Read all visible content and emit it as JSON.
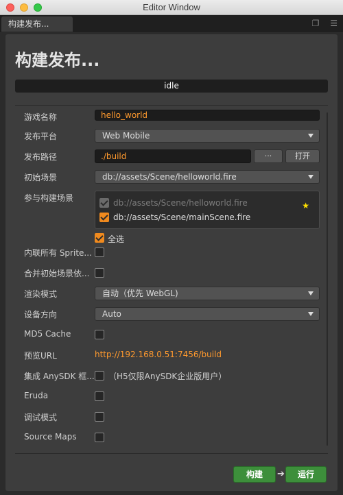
{
  "window": {
    "title": "Editor Window"
  },
  "tab": {
    "label": "构建发布..."
  },
  "panel": {
    "heading": "构建发布...",
    "status": "idle"
  },
  "fields": {
    "game_name": {
      "label": "游戏名称",
      "value": "hello_world"
    },
    "platform": {
      "label": "发布平台",
      "value": "Web Mobile"
    },
    "build_path": {
      "label": "发布路径",
      "value": "./build",
      "browse_label": "···",
      "open_label": "打开"
    },
    "start_scene": {
      "label": "初始场景",
      "value": "db://assets/Scene/helloworld.fire"
    },
    "build_scenes": {
      "label": "参与构建场景",
      "items": [
        {
          "name": "db://assets/Scene/helloworld.fire",
          "checked": true,
          "disabled": true
        },
        {
          "name": "db://assets/Scene/mainScene.fire",
          "checked": true,
          "disabled": false
        }
      ],
      "select_all_label": "全选"
    },
    "inline_sprite": {
      "label": "内联所有 Sprite..."
    },
    "merge_scene": {
      "label": "合并初始场景依..."
    },
    "render_mode": {
      "label": "渲染模式",
      "value": "自动（优先 WebGL)"
    },
    "orientation": {
      "label": "设备方向",
      "value": "Auto"
    },
    "md5": {
      "label": "MD5 Cache"
    },
    "preview_url": {
      "label": "预览URL",
      "value": "http://192.168.0.51:7456/build"
    },
    "anysdk": {
      "label": "集成 AnySDK 框...",
      "note": "（H5仅限AnySDK企业版用户）"
    },
    "eruda": {
      "label": "Eruda"
    },
    "debug": {
      "label": "调试模式"
    },
    "source_maps": {
      "label": "Source Maps"
    }
  },
  "footer": {
    "build_label": "构建",
    "run_label": "运行"
  },
  "colors": {
    "accent": "#f08a1e",
    "button_green": "#3d8f3b",
    "link": "#ff9a2e"
  }
}
